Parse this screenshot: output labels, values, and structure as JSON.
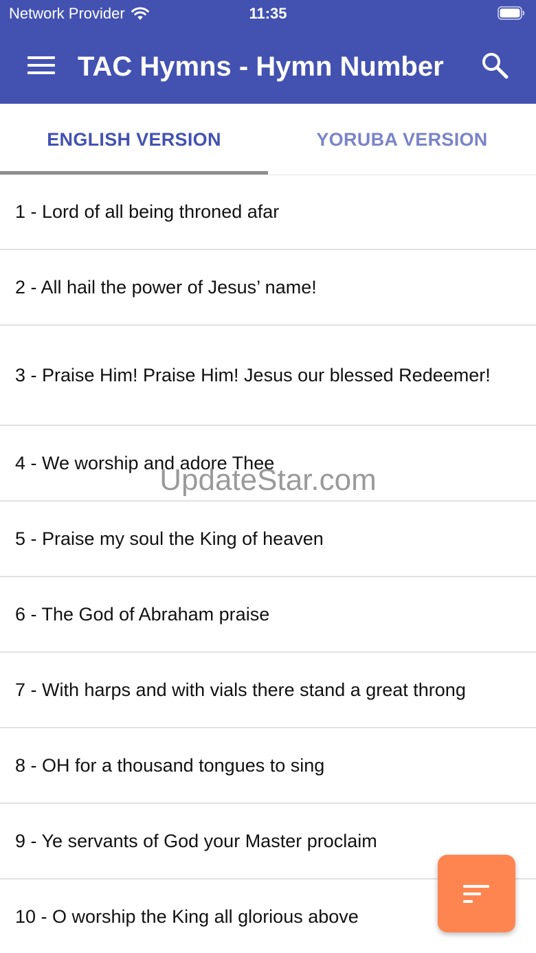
{
  "status_bar": {
    "carrier": "Network Provider",
    "time": "11:35"
  },
  "toolbar": {
    "title": "TAC Hymns - Hymn Number"
  },
  "tabs": [
    {
      "label": "ENGLISH VERSION",
      "selected": true
    },
    {
      "label": "YORUBA VERSION",
      "selected": false
    }
  ],
  "hymns": [
    "1 - Lord of all being throned afar",
    "2 - All hail the power of Jesus’ name!",
    "3 - Praise Him! Praise Him! Jesus our blessed Redeemer!",
    "4 - We worship and adore Thee",
    "5 - Praise my soul the King of heaven",
    "6 - The God of Abraham praise",
    "7 - With harps and with vials there stand a great throng",
    "8 - OH for a thousand tongues to sing",
    "9 - Ye servants of God your Master proclaim",
    "10 - O worship the King all glorious above"
  ],
  "watermark": "UpdateStar.com",
  "colors": {
    "primary": "#4352B1",
    "tab_active": "#4352B1",
    "tab_inactive": "#7A84C8",
    "fab": "#FF8550"
  },
  "icons": {
    "menu": "hamburger-menu-icon",
    "search": "search-icon",
    "sort": "sort-icon",
    "wifi": "wifi-icon",
    "battery": "battery-icon"
  }
}
